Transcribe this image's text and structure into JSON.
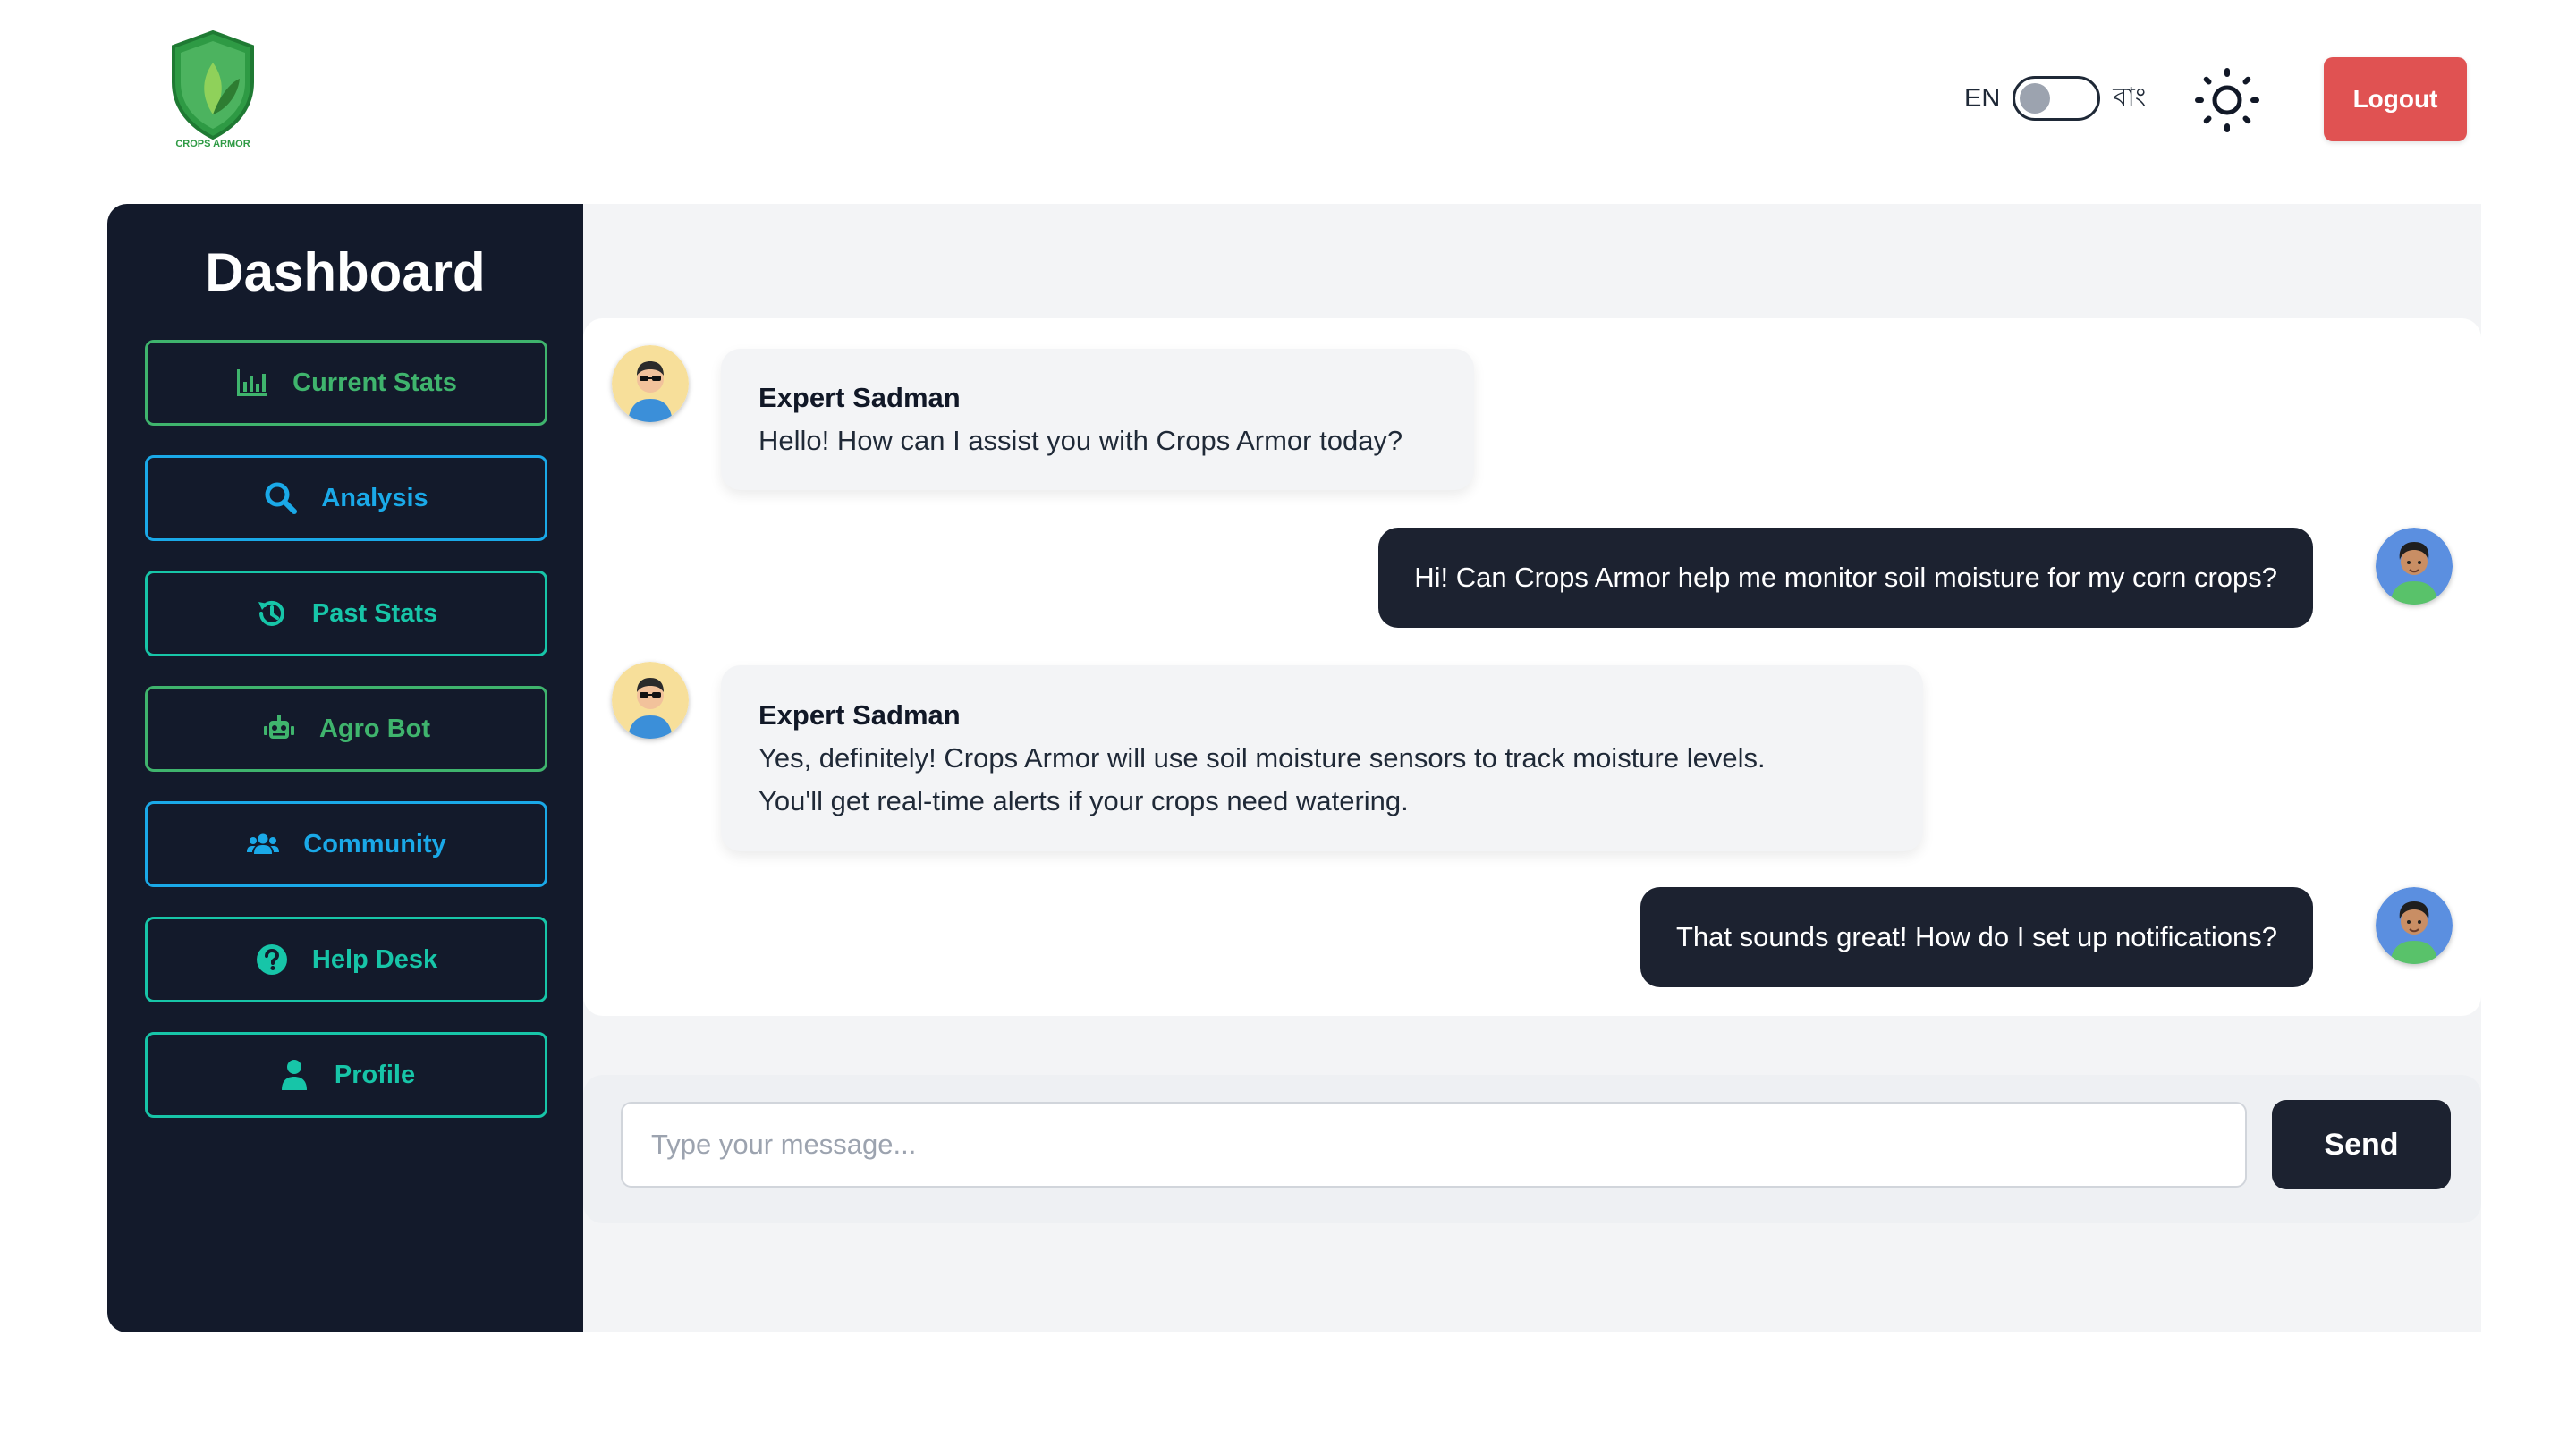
{
  "header": {
    "logo_text": "CROPS ARMOR",
    "language": {
      "left_label": "EN",
      "right_label": "বাং",
      "selected": "EN"
    },
    "theme_icon": "sun-icon",
    "logout_label": "Logout"
  },
  "sidebar": {
    "title": "Dashboard",
    "items": [
      {
        "label": "Current Stats",
        "icon": "bar-chart-icon",
        "color": "#3fb46d"
      },
      {
        "label": "Analysis",
        "icon": "search-icon",
        "color": "#1aa9e8"
      },
      {
        "label": "Past Stats",
        "icon": "history-icon",
        "color": "#17c5a8"
      },
      {
        "label": "Agro Bot",
        "icon": "robot-icon",
        "color": "#3fb46d"
      },
      {
        "label": "Community",
        "icon": "users-icon",
        "color": "#1aa9e8"
      },
      {
        "label": "Help Desk",
        "icon": "question-circle-icon",
        "color": "#17c5a8"
      },
      {
        "label": "Profile",
        "icon": "user-icon",
        "color": "#17c5a8"
      }
    ]
  },
  "chat": {
    "messages": [
      {
        "from": "expert",
        "sender": "Expert Sadman",
        "lines": [
          "Hello! How can I assist you with Crops Armor today?"
        ]
      },
      {
        "from": "user",
        "text": "Hi! Can Crops Armor help me monitor soil moisture for my corn crops?"
      },
      {
        "from": "expert",
        "sender": "Expert Sadman",
        "lines": [
          "Yes, definitely! Crops Armor will use soil moisture sensors to track moisture levels.",
          "You'll get real-time alerts if your crops need watering."
        ]
      },
      {
        "from": "user",
        "text": "That sounds great! How do I set up notifications?"
      }
    ]
  },
  "composer": {
    "placeholder": "Type your message...",
    "value": "",
    "send_label": "Send"
  },
  "colors": {
    "sidebar_bg": "#131a2b",
    "logout": "#e05252",
    "user_bubble": "#1c2230",
    "expert_bubble": "#f3f4f6"
  }
}
